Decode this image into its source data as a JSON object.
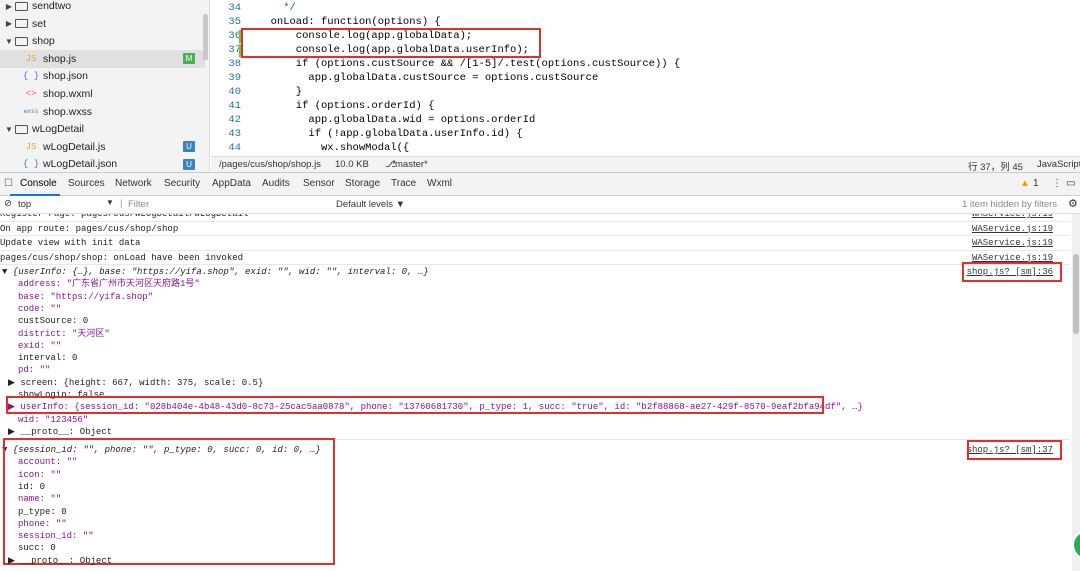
{
  "tree": {
    "items": [
      {
        "arrow": "▶",
        "type": "folder",
        "label": "sendtwo"
      },
      {
        "arrow": "▶",
        "type": "folder",
        "label": "set"
      },
      {
        "arrow": "▼",
        "type": "folder",
        "label": "shop"
      },
      {
        "icon": "JS",
        "type": "js",
        "label": "shop.js",
        "badge": "M"
      },
      {
        "icon": "{ }",
        "type": "json",
        "label": "shop.json"
      },
      {
        "icon": "<>",
        "type": "wxml",
        "label": "shop.wxml"
      },
      {
        "icon": "wxss",
        "type": "wxss",
        "label": "shop.wxss"
      },
      {
        "arrow": "▼",
        "type": "folder",
        "label": "wLogDetail"
      },
      {
        "icon": "JS",
        "type": "js",
        "label": "wLogDetail.js",
        "badge": "U"
      },
      {
        "icon": "{ }",
        "type": "json",
        "label": "wLogDetail.json",
        "badge": "U"
      }
    ]
  },
  "editor": {
    "lines": [
      {
        "num": "34",
        "text": "    */"
      },
      {
        "num": "35",
        "text": "  onLoad: function(options) {"
      },
      {
        "num": "36",
        "text": "      console.log(app.globalData);"
      },
      {
        "num": "37",
        "text": "      console.log(app.globalData.userInfo);"
      },
      {
        "num": "38",
        "text": "      if (options.custSource && /[1-5]/.test(options.custSource)) {"
      },
      {
        "num": "39",
        "text": "        app.globalData.custSource = options.custSource"
      },
      {
        "num": "40",
        "text": "      }"
      },
      {
        "num": "41",
        "text": "      if (options.orderId) {"
      },
      {
        "num": "42",
        "text": "        app.globalData.wid = options.orderId"
      },
      {
        "num": "43",
        "text": "        if (!app.globalData.userInfo.id) {"
      },
      {
        "num": "44",
        "text": "          wx.showModal({"
      }
    ]
  },
  "status": {
    "path": "/pages/cus/shop/shop.js",
    "size": "10.0 KB",
    "branch": "master*",
    "position": "行 37，列 45",
    "lang": "JavaScript"
  },
  "devtools": {
    "tabs": [
      "Console",
      "Sources",
      "Network",
      "Security",
      "AppData",
      "Audits",
      "Sensor",
      "Storage",
      "Trace",
      "Wxml"
    ],
    "warn_count": "1",
    "context": "top",
    "filter_placeholder": "Filter",
    "levels": "Default levels ▼",
    "hidden": "1 item hidden by filters"
  },
  "console": {
    "lines": [
      {
        "text": "Register Page: pages/cus/wLogDetail/wLogDetail",
        "src": "WAService.js:19"
      },
      {
        "text": "On app route: pages/cus/shop/shop",
        "src": "WAService.js:19"
      },
      {
        "text": "Update view with init data",
        "src": "WAService.js:19"
      },
      {
        "text": "pages/cus/shop/shop: onLoad have been invoked",
        "src": "WAService.js:19"
      }
    ],
    "obj1_header": "▼ {userInfo: {…}, base: \"https://yifa.shop\", exid: \"\", wid: \"\", interval: 0, …}",
    "obj1_src": "shop.js? [sm]:36",
    "obj1_props": [
      "address: \"广东省广州市天河区天府路1号\"",
      "base: \"https://yifa.shop\"",
      "code: \"\"",
      "custSource: 0",
      "district: \"天河区\"",
      "exid: \"\"",
      "interval: 0",
      "pd: \"\"",
      "▶ screen: {height: 667, width: 375, scale: 0.5}",
      "showLogin: false",
      "▶ userInfo: {session_id: \"028b404e-4b48-43d0-8c73-25cac5aa0878\", phone: \"13760681730\", p_type: 1, succ: \"true\", id: \"b2f88868-ae27-429f-8570-9eaf2bfa94df\", …}",
      "wid: \"123456\"",
      "▶ __proto__: Object"
    ],
    "obj2_header": "▼ {session_id: \"\", phone: \"\", p_type: 0, succ: 0, id: 0, …}",
    "obj2_src": "shop.js? [sm]:37",
    "obj2_props": [
      "account: \"\"",
      "icon: \"\"",
      "id: 0",
      "name: \"\"",
      "p_type: 0",
      "phone: \"\"",
      "session_id: \"\"",
      "succ: 0",
      "▶ __proto__: Object"
    ]
  },
  "colors": {
    "highlight_box": "#e0302a",
    "modified_badge": "#4caf50",
    "untracked_badge": "#3b82c4"
  }
}
